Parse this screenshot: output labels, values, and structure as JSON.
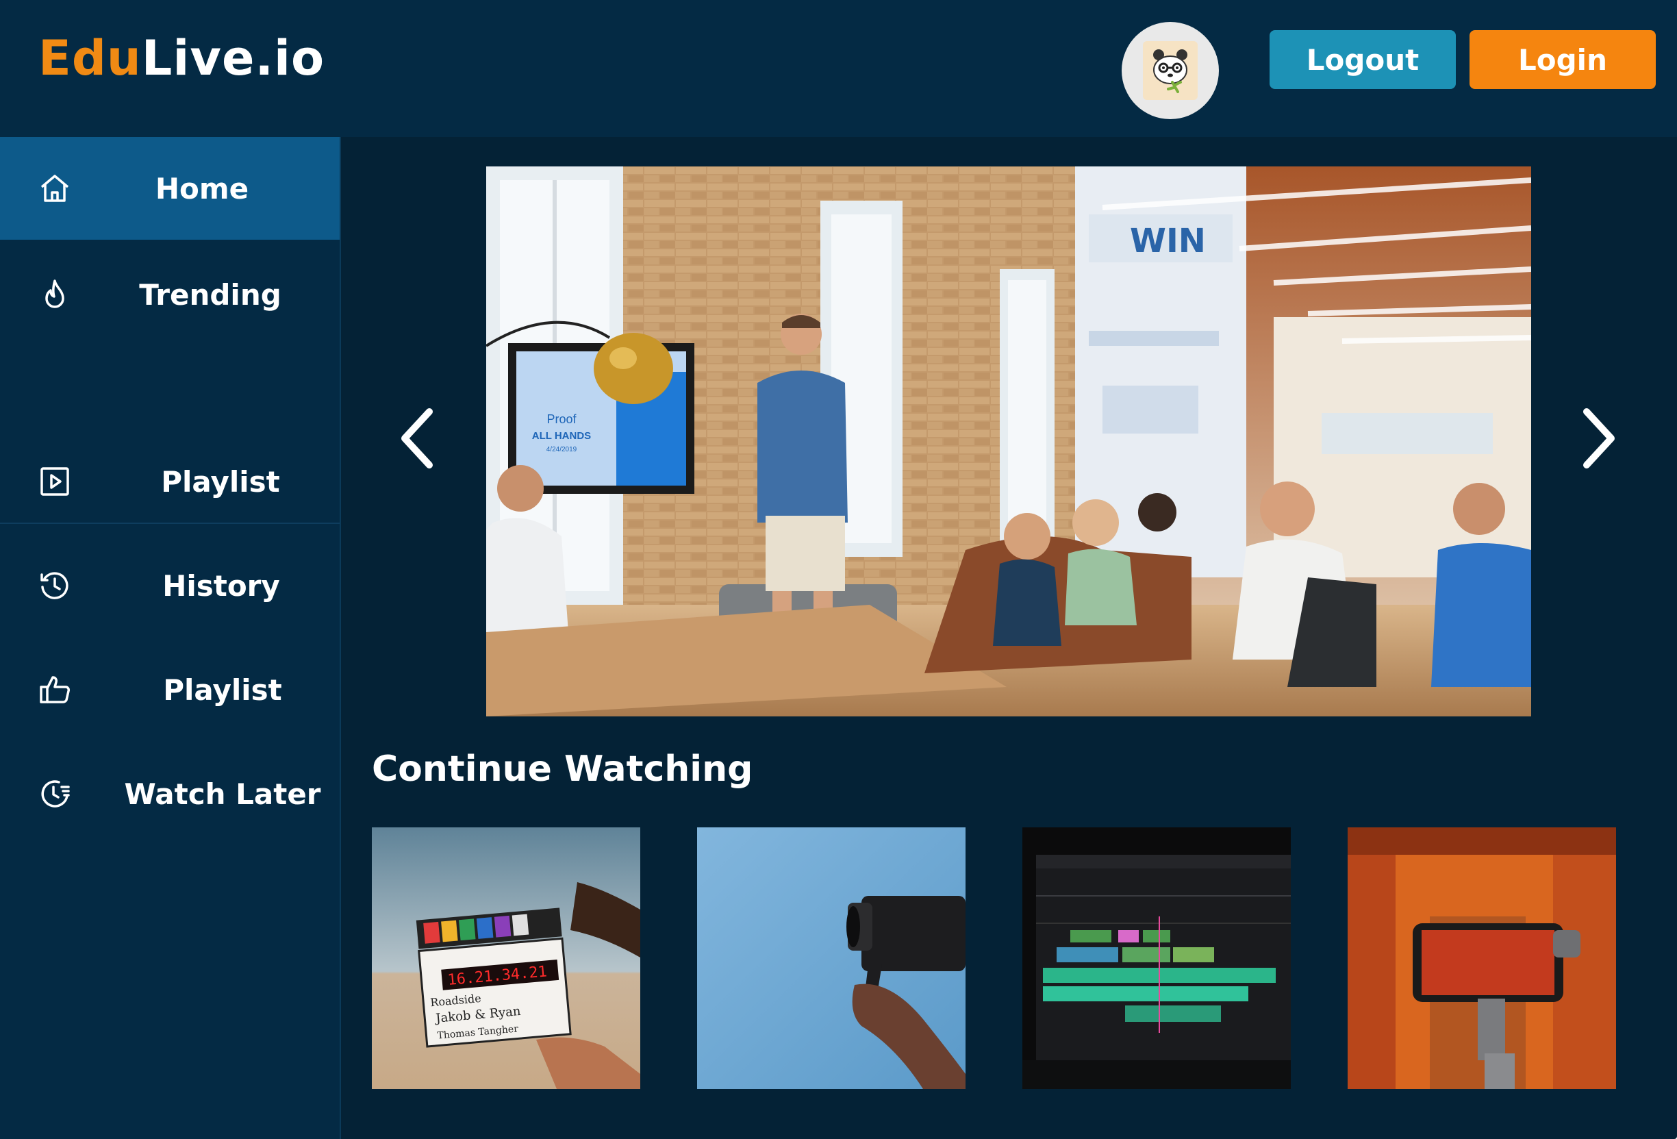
{
  "brand": {
    "part1": "Edu",
    "part2": "Live.io"
  },
  "header": {
    "logout_label": "Logout",
    "login_label": "Login"
  },
  "sidebar": {
    "items": [
      {
        "label": "Home",
        "icon": "home-icon"
      },
      {
        "label": "Trending",
        "icon": "flame-icon"
      },
      {
        "label": "Playlist",
        "icon": "play-square-icon"
      },
      {
        "label": "History",
        "icon": "history-icon"
      },
      {
        "label": "Playlist",
        "icon": "thumbs-up-icon"
      },
      {
        "label": "Watch Later",
        "icon": "watch-later-icon"
      }
    ]
  },
  "hero": {
    "screen_title": "Proof",
    "screen_subtitle": "ALL HANDS",
    "screen_date": "4/24/2019",
    "wall_text": "WIN"
  },
  "continue": {
    "title": "Continue Watching",
    "clapper": {
      "line1": "16.21.34.21",
      "line2": "Roadside",
      "line3": "Jakob & Ryan",
      "line4": "Thomas Tangher"
    }
  },
  "colors": {
    "accent_orange": "#f5850f",
    "accent_teal": "#1d92b6",
    "active_nav": "#0d5a8a",
    "background": "#042236"
  }
}
